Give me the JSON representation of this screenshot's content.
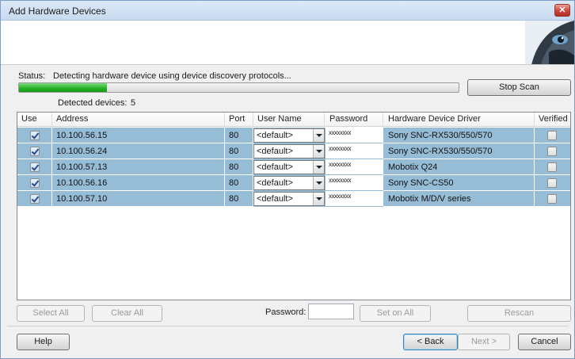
{
  "window": {
    "title": "Add Hardware Devices",
    "close_label": "✕"
  },
  "status": {
    "label": "Status:",
    "text": "Detecting hardware device using device discovery protocols...",
    "progress": 0.2,
    "detected_label": "Detected devices:",
    "detected_count": "5"
  },
  "buttons": {
    "stop_scan": "Stop Scan",
    "select_all": "Select All",
    "clear_all": "Clear All",
    "set_on_all": "Set on All",
    "rescan": "Rescan",
    "help": "Help",
    "back": "< Back",
    "next": "Next >",
    "cancel": "Cancel"
  },
  "password_label": "Password:",
  "table": {
    "headers": [
      "Use",
      "Address",
      "Port",
      "User Name",
      "Password",
      "Hardware Device Driver",
      "Verified"
    ],
    "rows": [
      {
        "use": true,
        "address": "10.100.56.15",
        "port": "80",
        "user": "<default>",
        "password": "xxxxxxxx",
        "driver": "Sony SNC-RX530/550/570",
        "verified": false
      },
      {
        "use": true,
        "address": "10.100.56.24",
        "port": "80",
        "user": "<default>",
        "password": "xxxxxxxx",
        "driver": "Sony SNC-RX530/550/570",
        "verified": false
      },
      {
        "use": true,
        "address": "10.100.57.13",
        "port": "80",
        "user": "<default>",
        "password": "xxxxxxxx",
        "driver": "Mobotix Q24",
        "verified": false
      },
      {
        "use": true,
        "address": "10.100.56.16",
        "port": "80",
        "user": "<default>",
        "password": "xxxxxxxx",
        "driver": "Sony SNC-CS50",
        "verified": false
      },
      {
        "use": true,
        "address": "10.100.57.10",
        "port": "80",
        "user": "<default>",
        "password": "xxxxxxxx",
        "driver": "Mobotix M/D/V series",
        "verified": false
      }
    ]
  },
  "colors": {
    "row_selected": "#97bdd6",
    "progress": "#22b022"
  }
}
